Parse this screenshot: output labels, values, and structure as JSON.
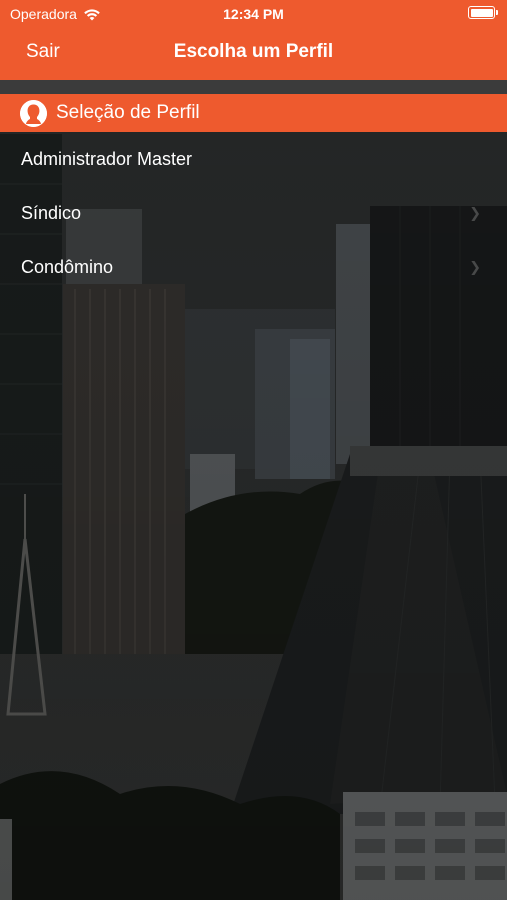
{
  "status_bar": {
    "carrier": "Operadora",
    "time": "12:34 PM"
  },
  "nav": {
    "back_label": "Sair",
    "title": "Escolha um Perfil"
  },
  "section": {
    "title": "Seleção de Perfil",
    "icon": "user-silhouette-icon"
  },
  "profiles": [
    {
      "label": "Administrador Master"
    },
    {
      "label": "Síndico"
    },
    {
      "label": "Condômino"
    }
  ],
  "colors": {
    "accent": "#ee5a2e",
    "text": "#ffffff"
  }
}
